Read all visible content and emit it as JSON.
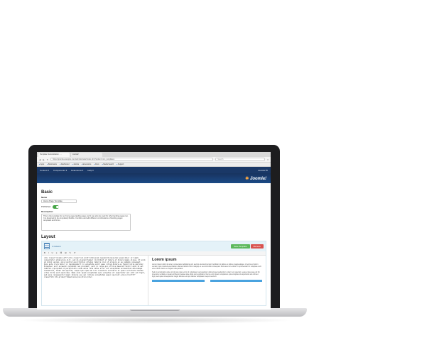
{
  "browser": {
    "tabs": [
      "Template Customization · ...",
      "Joomla!"
    ],
    "address": "https://joomla.example.com/administrator/index.php?option=com_templates",
    "search_placeholder": "Search",
    "bookmarks": [
      "Apps",
      "Bookmarks",
      "Dashboard",
      "Joomla",
      "Extensions",
      "Docs",
      "Media Search",
      "Support"
    ]
  },
  "admin": {
    "menu": [
      "Content ▾",
      "Components ▾",
      "Extensions ▾",
      "Help ▾"
    ],
    "user": "Joomla! ⚙",
    "logo": "Joomla!"
  },
  "basic": {
    "title": "Basic",
    "name_label": "Name",
    "name_value": "Home Page Template",
    "published_label": "Published",
    "description_label": "Description",
    "description_value": "This is the template for our home page landing page and it can also be used for other landing pages too. It is designed to be completely flexible. Combine and add different combinations of landing pages templates and forms."
  },
  "layout": {
    "title": "Layout",
    "column_label": "1 Column",
    "save_label": "Save Template",
    "remove_label": "Remove",
    "tools": [
      "B",
      "I",
      "U",
      "≡",
      "⌘",
      "⊞",
      "✎",
      "↺"
    ],
    "code": "<div class=\"column_left\"><div class=\"col-md-6\"><h1>Lorem ipsum</h1><p>Lorem ipsum dolor sit amet, consectetur adipiscing elit, sed do eiusmod tempor incididunt ut labore et dolore magna aliqua. Ut enim ad minim veniam, quis nostrud exercitation ullamco laboris nisi ut aliquip ex ea commodo consequat. Duis aute irure dolor in reprehenderit in voluptate velit esse cillum dolore eu fugiat nulla pariatur. Excepteur sint occaecat cupidatat non proident, sunt in culpa qui officia deserunt mollit anim id est laborum.</p><p>Sed ut perspiciatis unde omnis iste natus error sit voluptatem accusantium doloremque laudantium, totam rem aperiam, eaque ipsa quae ab illo inventore veritatis et quasi architecto beatae vitae dicta sunt explicabo. Nemo enim ipsam voluptatem quia voluptas sit aspernatur aut odit aut fugit, sed quia consequuntur magni dolores eos qui ratione voluptatem sequi nesciunt.</p><a href=\"#\" class=\"btn btn-primary\">Read more</a></div></div>",
    "preview_title": "Lorem ipsum",
    "preview_p1": "Lorem ipsum dolor sit amet, consectetur adipiscing elit, sed do eiusmod tempor incididunt ut labore et dolore magna aliqua. Ut enim ad minim veniam, quis nostrud exercitation ullamco laboris nisi ut aliquip ex ea commodo consequat. Duis aute irure dolor in reprehenderit in voluptate velit esse cillum dolore eu fugiat nulla pariatur.",
    "preview_p2": "Sed ut perspiciatis unde omnis iste natus error sit voluptatem accusantium doloremque laudantium, totam rem aperiam, eaque ipsa quae ab illo inventore veritatis et quasi architecto beatae vitae dicta sunt explicabo. Nemo enim ipsam voluptatem quia voluptas sit aspernatur aut odit aut fugit, sed quia consequuntur magni dolores eos qui ratione voluptatem sequi nesciunt."
  }
}
